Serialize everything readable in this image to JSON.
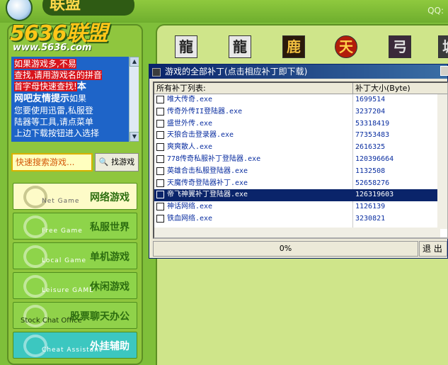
{
  "header": {
    "title": "联盟",
    "brand": "5636联盟",
    "url": "www.5636.com",
    "qq_label": "QQ:"
  },
  "ad": {
    "line1": "如果游戏多,不易",
    "line2": "查找,请用游戏名的拼音",
    "line3": "首字母快速查找!",
    "line3b": "本",
    "line4": "网吧友情提示",
    "line4b": "如果",
    "line5": "您要使用迅雷,私服登",
    "line6": "陆器等工具,请点菜单",
    "line7": "上边下载按钮进入选择"
  },
  "search": {
    "placeholder": "快速搜索游戏...",
    "button_label": "找游戏"
  },
  "categories": [
    {
      "en": "Net Game",
      "cn": "网络游戏"
    },
    {
      "en": "Free Game",
      "cn": "私服世界"
    },
    {
      "en": "Local Game",
      "cn": "单机游戏"
    },
    {
      "en": "Leisure GAME",
      "cn": "休闲游戏"
    },
    {
      "en": "Stock Chat Office",
      "cn": "股票聊天办公"
    },
    {
      "en": "Cheat Assistant",
      "cn": "外挂辅助"
    }
  ],
  "game_icons": [
    "龍",
    "龍",
    "鹿",
    "天",
    "弓",
    "城"
  ],
  "dialog": {
    "title": "游戏的全部补丁(点击相应补丁即下载)",
    "col_name": "所有补丁列表:",
    "col_size": "补丁大小(Byte)",
    "rows": [
      {
        "name": "唯大传奇.exe",
        "size": "1699514"
      },
      {
        "name": "传奇外传II登陆器.exe",
        "size": "3237204"
      },
      {
        "name": "盛世外传.exe",
        "size": "53318419"
      },
      {
        "name": "天狼合击登录器.exe",
        "size": "77353483"
      },
      {
        "name": "爽爽散人.exe",
        "size": "2616325"
      },
      {
        "name": "778传奇私服补丁登陆器.exe",
        "size": "120396664"
      },
      {
        "name": "英雄合击私服登陆器.exe",
        "size": "1132508"
      },
      {
        "name": "天魔传奇登陆器补丁.exe",
        "size": "52658276"
      },
      {
        "name": "帝飞神翼补丁登陆器.exe",
        "size": "126319603"
      },
      {
        "name": "神话网络.exe",
        "size": "1126139"
      },
      {
        "name": "铁血网络.exe",
        "size": "3230821"
      }
    ],
    "selected_index": 8,
    "progress_text": "0%",
    "exit_label": "退  出"
  },
  "colors": {
    "bg_green": "#7fbf3a",
    "selection": "#0a246a",
    "ad_bg": "#1e64c8",
    "ad_red": "#d8141c"
  }
}
